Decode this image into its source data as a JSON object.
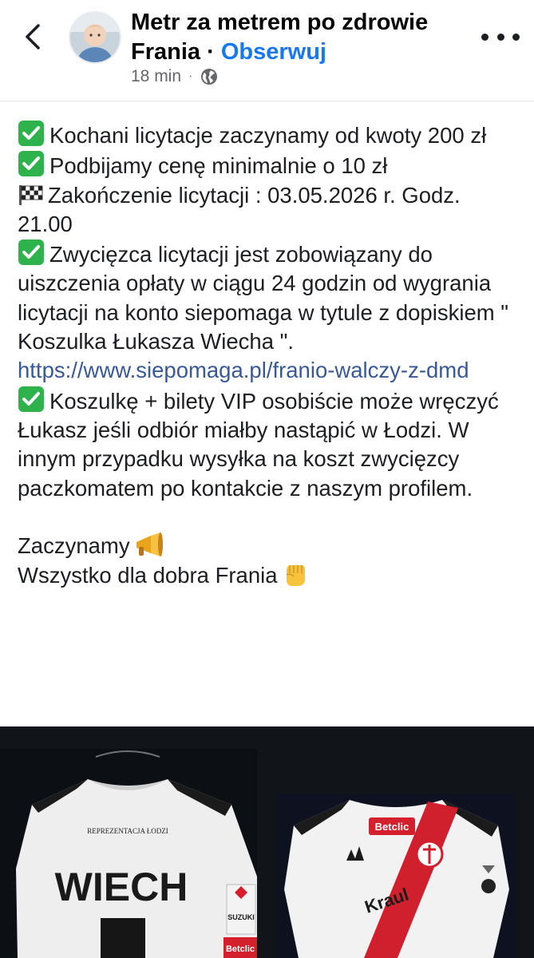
{
  "header": {
    "page_name": "Metr za metrem po zdrowie Frania",
    "separator": "·",
    "follow_label": "Obserwuj",
    "time": "18 min",
    "meta_separator": "·",
    "icons": {
      "back": "chevron-left-icon",
      "privacy": "globe-icon",
      "more": "more-horizontal-icon"
    }
  },
  "post": {
    "line1": "Kochani licytacje zaczynamy od kwoty 200 zł",
    "line2": "Podbijamy cenę minimalnie o 10 zł",
    "line3": "Zakończenie licytacji : 03.05.2026 r. Godz. 21.00",
    "line4": "Zwycięzca licytacji jest zobowiązany do uiszczenia opłaty w ciągu 24 godzin od wygrania licytacji na konto siepomaga w tytule z dopiskiem \" Koszulka Łukasza Wiecha \".",
    "link": "https://www.siepomaga.pl/franio-walczy-z-dmd",
    "line5": "Koszulkę + bilety VIP osobiście może wręczyć Łukasz jeśli odbiór miałby nastąpić w Łodzi. W innym przypadku  wysyłka na koszt zwycięzcy paczkomatem po kontakcie z naszym profilem.",
    "line6": "Zaczynamy",
    "line7": "Wszystko dla dobra Frania",
    "icons": {
      "check": "check-mark-emoji-icon",
      "flag": "checkered-flag-emoji-icon",
      "megaphone": "megaphone-emoji-icon",
      "fist": "raised-fist-emoji-icon"
    }
  },
  "photos": {
    "photo1": {
      "caption_small": "REPREZENTACJA ŁODZI",
      "player_name": "WIECH",
      "sponsor": "SUZUKI",
      "sponsor2": "Betclic"
    },
    "photo2": {
      "sponsor": "Betclic",
      "sponsor_side": "Kraul"
    }
  },
  "colors": {
    "link": "#385898",
    "follow": "#1877f2",
    "meta": "#65676b",
    "check_bg": "#2eb24c",
    "gallery_bg": "#111418"
  }
}
